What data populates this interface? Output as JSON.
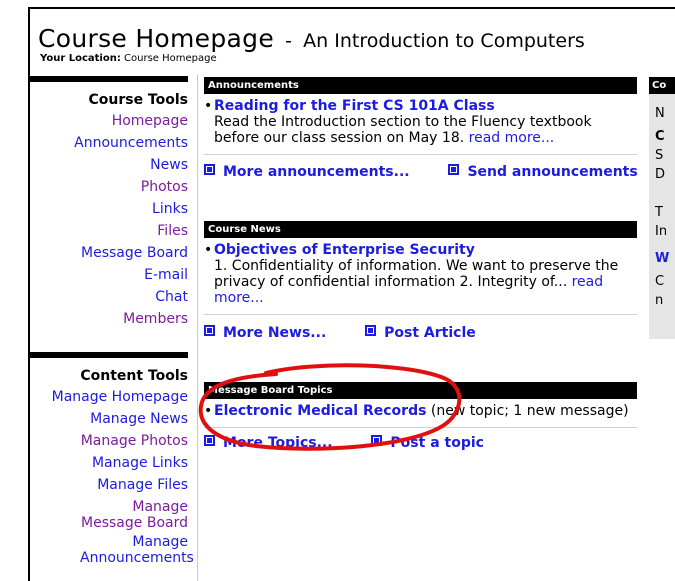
{
  "header": {
    "title": "Course Homepage",
    "separator": "-",
    "subtitle": "An Introduction to Computers",
    "location_label": "Your Location:",
    "location_value": "Course Homepage"
  },
  "course_tools": {
    "heading": "Course Tools",
    "items": [
      "Homepage",
      "Announcements",
      "News",
      "Photos",
      "Links",
      "Files",
      "Message Board",
      "E-mail",
      "Chat",
      "Members"
    ]
  },
  "content_tools": {
    "heading": "Content Tools",
    "items": [
      "Manage Homepage",
      "Manage News",
      "Manage Photos",
      "Manage Links",
      "Manage Files",
      "Manage Message Board",
      "Manage Announcements"
    ]
  },
  "announcements": {
    "header": "Announcements",
    "item_title": "Reading for the First CS 101A Class",
    "item_body": "Read the Introduction section to the Fluency textbook before our class session on May 18.",
    "read_more": "read more...",
    "more_link": "More announcements...",
    "send_link": "Send announcements"
  },
  "course_news": {
    "header": "Course News",
    "item_title": "Objectives of Enterprise Security",
    "item_body": "1. Confidentiality of information. We want to preserve the privacy of confidential information 2. Integrity of...",
    "read_more": "read more...",
    "more_link": "More News...",
    "post_link": "Post Article"
  },
  "message_board": {
    "header": "Message Board Topics",
    "item_title": "Electronic Medical Records",
    "item_meta": "(new topic; 1 new message)",
    "more_link": "More Topics...",
    "post_link": "Post a topic"
  },
  "right_column": {
    "header": "Co",
    "lines": [
      "N",
      "C",
      "S",
      "D",
      "",
      "T",
      "In",
      "",
      "W",
      "",
      "C",
      "n"
    ]
  },
  "colors": {
    "link": "#1c1ce0",
    "visited": "#7a1d9b",
    "highlight_circle": "#e01010"
  }
}
